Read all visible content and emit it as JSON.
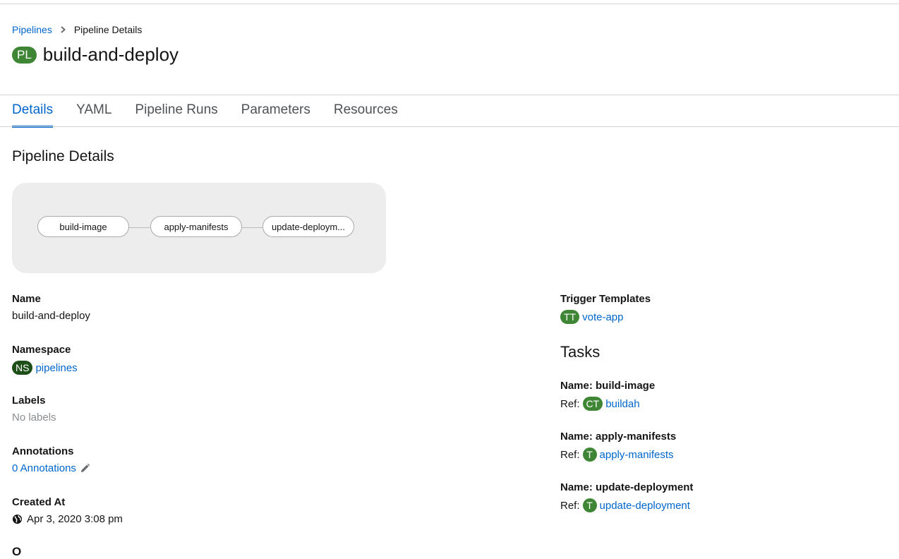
{
  "breadcrumb": {
    "parent": "Pipelines",
    "current": "Pipeline Details"
  },
  "header": {
    "badge": "PL",
    "title": "build-and-deploy"
  },
  "tabs": [
    {
      "label": "Details",
      "active": true
    },
    {
      "label": "YAML"
    },
    {
      "label": "Pipeline Runs"
    },
    {
      "label": "Parameters"
    },
    {
      "label": "Resources"
    }
  ],
  "section_title": "Pipeline Details",
  "topology": {
    "nodes": [
      "build-image",
      "apply-manifests",
      "update-deploym..."
    ]
  },
  "details": {
    "name_label": "Name",
    "name_value": "build-and-deploy",
    "namespace_label": "Namespace",
    "namespace_badge": "NS",
    "namespace_value": "pipelines",
    "labels_label": "Labels",
    "labels_value": "No labels",
    "annotations_label": "Annotations",
    "annotations_value": "0 Annotations",
    "created_label": "Created At",
    "created_value": "Apr 3, 2020 3:08 pm",
    "clipped_label": "O"
  },
  "trigger_templates": {
    "label": "Trigger Templates",
    "badge": "TT",
    "value": "vote-app"
  },
  "tasks": {
    "heading": "Tasks",
    "ref_prefix": "Ref:",
    "items": [
      {
        "name": "Name: build-image",
        "badge": "CT",
        "ref": "buildah"
      },
      {
        "name": "Name: apply-manifests",
        "badge": "T",
        "ref": "apply-manifests"
      },
      {
        "name": "Name: update-deployment",
        "badge": "T",
        "ref": "update-deployment"
      }
    ]
  },
  "colors": {
    "link": "#0066cc",
    "badge_green": "#3e8635",
    "badge_dark_green": "#1e4f18"
  },
  "icons": {
    "breadcrumb_separator": "chevron-right-icon",
    "edit": "pencil-icon",
    "globe": "globe-icon"
  }
}
